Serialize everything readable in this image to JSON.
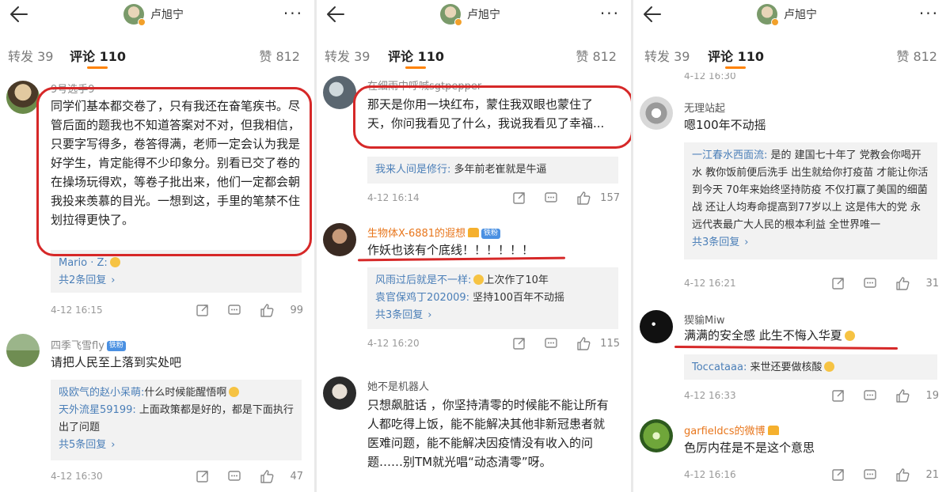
{
  "header": {
    "user_name": "卢旭宁",
    "more_label": "···"
  },
  "tabs": {
    "repost": "转发 39",
    "comments": "评论 110",
    "likes": "赞 812"
  },
  "panel1": {
    "c1": {
      "user": "9号选手9",
      "text": "同学们基本都交卷了，只有我还在奋笔疾书。尽管后面的题我也不知道答案对不对，但我相信，只要字写得多，卷答得满，老师一定会认为我是好学生，肯定能得不少印象分。别看已交了卷的在操场玩得欢，等卷子批出来，他们一定都会朝我投来羡慕的目光。一想到这，手里的笔禁不住划拉得更快了。",
      "reply1_name": "Mario · Z:",
      "more": "共2条回复",
      "time": "4-12 16:15",
      "likes": "99"
    },
    "c2": {
      "user": "四季飞雪fly",
      "badge": "铁粉",
      "text": "请把人民至上落到实处吧",
      "reply1_name": "吸欧气的赵小呆萌:",
      "reply1_text": "什么时候能醒悟啊",
      "reply2_name": "天外流星59199:",
      "reply2_text": "上面政策都是好的，都是下面执行出了问题",
      "more": "共5条回复",
      "time": "4-12 16:30",
      "likes": "47"
    }
  },
  "panel2": {
    "c1": {
      "user": "在细雨中呼喊sgtpepper",
      "text": "那天是你用一块红布，蒙住我双眼也蒙住了天，你问我看见了什么，我说我看见了幸福...",
      "reply1_name": "我来人间是修行:",
      "reply1_text": "多年前老崔就是牛逼",
      "time": "4-12 16:14",
      "likes": "157"
    },
    "c2": {
      "user": "生物体X-6881的遐想",
      "badge": "铁粉",
      "text": "作妖也该有个底线！！！！！！",
      "reply1_name": "风雨过后就是不一样:",
      "reply1_text": "上次作了10年",
      "reply2_name": "袁官保鸡丁202009:",
      "reply2_text": "坚持100百年不动摇",
      "more": "共3条回复",
      "time": "4-12 16:20",
      "likes": "115"
    },
    "c3": {
      "user": "她不是机器人",
      "text": "只想飙脏话 ，你坚持清零的时候能不能让所有人都吃得上饭，能不能解决其他非新冠患者就医难问题，能不能解决因疫情没有收入的问题……别TM就光唱“动态清零”呀。"
    }
  },
  "panel3": {
    "c0": {
      "time": "4-12 16:30"
    },
    "c1": {
      "user": "无理站起",
      "text": "嗯100年不动摇",
      "reply1_name": "一江春水西面流:",
      "reply1_text": "是的 建国七十年了 党教会你喝开水 教你饭前便后洗手 出生就给你打疫苗 才能让你活到今天 70年来始终坚持防疫 不仅打赢了美国的细菌战 还让人均寿命提高到77岁以上 这是伟大的党 永远代表最广大人民的根本利益 全世界唯一",
      "more": "共3条回复",
      "time": "4-12 16:21",
      "likes": "31"
    },
    "c2": {
      "user": "猰貐Miw",
      "text": "满满的安全感 此生不悔入华夏",
      "reply1_name": "Toccataaa:",
      "reply1_text": "来世还要做核酸",
      "time": "4-12 16:33",
      "likes": "19"
    },
    "c3": {
      "user": "garfieldcs的微博",
      "text": "色厉内荏是不是这个意思",
      "time": "4-12 16:16",
      "likes": "21"
    }
  },
  "colors": {
    "accent": "#ff8200",
    "link": "#4b7fb8",
    "annotation": "#d62828",
    "orange_name": "#e8761c"
  }
}
